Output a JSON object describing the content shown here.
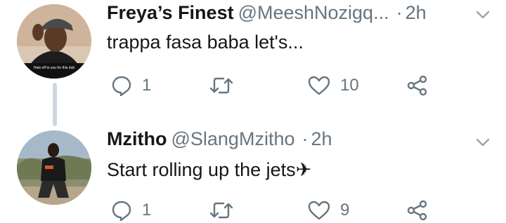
{
  "tweets": [
    {
      "display_name": "Freya’s Finest",
      "handle": "@MeeshNozigq...",
      "separator": "·",
      "time": "2h",
      "text": "trappa fasa baba let's...",
      "avatar_caption": "Hats off to you for this dub",
      "reply_count": "1",
      "retweet_count": "",
      "like_count": "10"
    },
    {
      "display_name": "Mzitho",
      "handle": "@SlangMzitho",
      "separator": "·",
      "time": "2h",
      "text": "Start rolling up the jets✈",
      "avatar_caption": "",
      "reply_count": "1",
      "retweet_count": "",
      "like_count": "9"
    }
  ],
  "icons": {
    "reply": "reply-icon",
    "retweet": "retweet-icon",
    "like": "heart-icon",
    "share": "share-icon",
    "menu": "chevron-down-icon"
  },
  "colors": {
    "icon": "#66757f",
    "name": "#14171a",
    "meta": "#66757f",
    "thread_line": "#cfd6dc"
  }
}
